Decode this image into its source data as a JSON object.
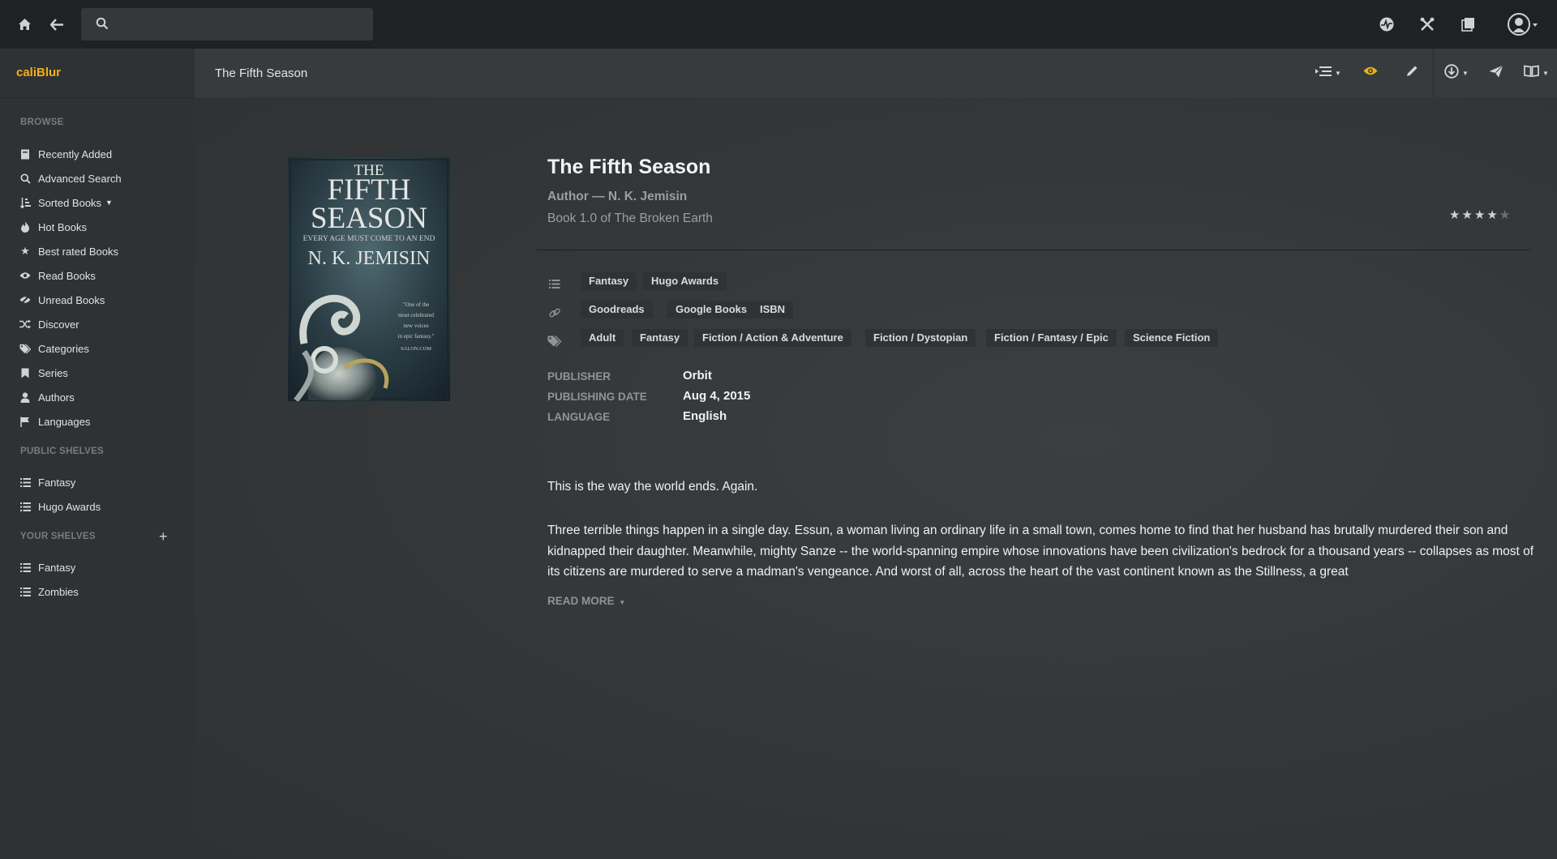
{
  "topbar": {
    "search": {
      "placeholder": "",
      "value": ""
    },
    "icons": [
      "home-icon",
      "back-arrow-icon",
      "search-icon",
      "activity-icon",
      "tools-icon",
      "books-icon",
      "user-avatar-icon"
    ]
  },
  "brand": "caliBlur",
  "sidebar": {
    "browse_heading": "BROWSE",
    "browse": [
      {
        "label": "Recently Added",
        "icon": "book-icon"
      },
      {
        "label": "Advanced Search",
        "icon": "search-icon"
      },
      {
        "label": "Sorted Books",
        "icon": "sort-icon",
        "has_caret": true
      },
      {
        "label": "Hot Books",
        "icon": "fire-icon"
      },
      {
        "label": "Best rated Books",
        "icon": "star-icon"
      },
      {
        "label": "Read Books",
        "icon": "eye-icon"
      },
      {
        "label": "Unread Books",
        "icon": "eye-slash-icon"
      },
      {
        "label": "Discover",
        "icon": "shuffle-icon"
      },
      {
        "label": "Categories",
        "icon": "tags-icon"
      },
      {
        "label": "Series",
        "icon": "bookmark-icon"
      },
      {
        "label": "Authors",
        "icon": "user-icon"
      },
      {
        "label": "Languages",
        "icon": "flag-icon"
      }
    ],
    "public_heading": "PUBLIC SHELVES",
    "public_shelves": [
      {
        "label": "Fantasy"
      },
      {
        "label": "Hugo Awards"
      }
    ],
    "your_heading": "YOUR SHELVES",
    "your_shelves": [
      {
        "label": "Fantasy"
      },
      {
        "label": "Zombies"
      }
    ]
  },
  "header": {
    "title": "The Fifth Season"
  },
  "book": {
    "cover": {
      "title_line1": "THE",
      "title_line2": "FIFTH",
      "title_line3": "SEASON",
      "tagline": "EVERY AGE MUST COME TO AN END",
      "author": "N. K. JEMISIN",
      "blurb": [
        "\"One of the",
        "most celebrated",
        "new voices",
        "in epic fantasy.\"",
        "SALON.COM"
      ]
    },
    "title": "The Fifth Season",
    "author_line": "Author — N. K. Jemisin",
    "series_line": "Book 1.0 of The Broken Earth",
    "rating": 4,
    "rating_max": 5,
    "shelves": [
      "Fantasy",
      "Hugo Awards"
    ],
    "links": [
      "Goodreads",
      "Google Books",
      "ISBN"
    ],
    "tags": [
      "Adult",
      "Fantasy",
      "Fiction / Action & Adventure",
      "Fiction / Dystopian",
      "Fiction / Fantasy / Epic",
      "Science Fiction"
    ],
    "meta": {
      "publisher_label": "PUBLISHER",
      "publisher": "Orbit",
      "date_label": "PUBLISHING DATE",
      "date": "Aug 4, 2015",
      "language_label": "LANGUAGE",
      "language": "English"
    },
    "description_p1": "This is the way the world ends. Again.",
    "description_p2": "Three terrible things happen in a single day. Essun, a woman living an ordinary life in a small town, comes home to find that her husband has brutally murdered their son and kidnapped their daughter. Meanwhile, mighty Sanze -- the world-spanning empire whose innovations have been civilization's bedrock for a thousand years -- collapses as most of its citizens are murdered to serve a madman's vengeance. And worst of all, across the heart of the vast continent known as the Stillness, a great",
    "read_more": "READ MORE"
  },
  "colors": {
    "accent": "#f0b21a",
    "topbar": "#1f2123",
    "sidebar": "#2f3234",
    "header": "#383b3d"
  }
}
